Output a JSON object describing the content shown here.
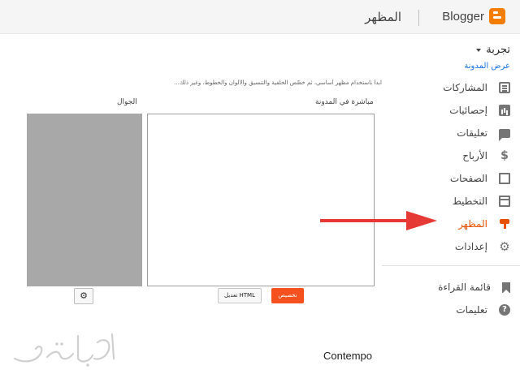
{
  "header": {
    "brand": "Blogger",
    "page_title": "المظهر"
  },
  "sidebar": {
    "blog_name": "تجربة",
    "view_blog": "عرض المدونة",
    "items": [
      {
        "label": "المشاركات",
        "icon": "posts-icon"
      },
      {
        "label": "إحصائيات",
        "icon": "stats-icon"
      },
      {
        "label": "تعليقات",
        "icon": "comments-icon"
      },
      {
        "label": "الأرباح",
        "icon": "earnings-icon"
      },
      {
        "label": "الصفحات",
        "icon": "pages-icon"
      },
      {
        "label": "التخطيط",
        "icon": "layout-icon"
      },
      {
        "label": "المظهر",
        "icon": "theme-icon",
        "active": true
      },
      {
        "label": "إعدادات",
        "icon": "settings-icon"
      }
    ],
    "secondary": [
      {
        "label": "قائمة القراءة",
        "icon": "bookmark-icon"
      },
      {
        "label": "تعليمات",
        "icon": "help-icon"
      }
    ]
  },
  "main": {
    "theme_description": "ابدأ باستخدام مظهر أساسي، ثم خصِّص الخلفية والتنسيق والألوان والخطوط، وغير ذلك...",
    "live_label": "مباشرة في المدونة",
    "mobile_label": "الجوال",
    "customize_button": "تخصيص",
    "edit_html_button": "تعديل HTML",
    "theme_name": "Contempo"
  },
  "colors": {
    "accent": "#e65100",
    "customize_button": "#f4511e",
    "arrow": "#e53935",
    "link": "#1a73e8"
  }
}
